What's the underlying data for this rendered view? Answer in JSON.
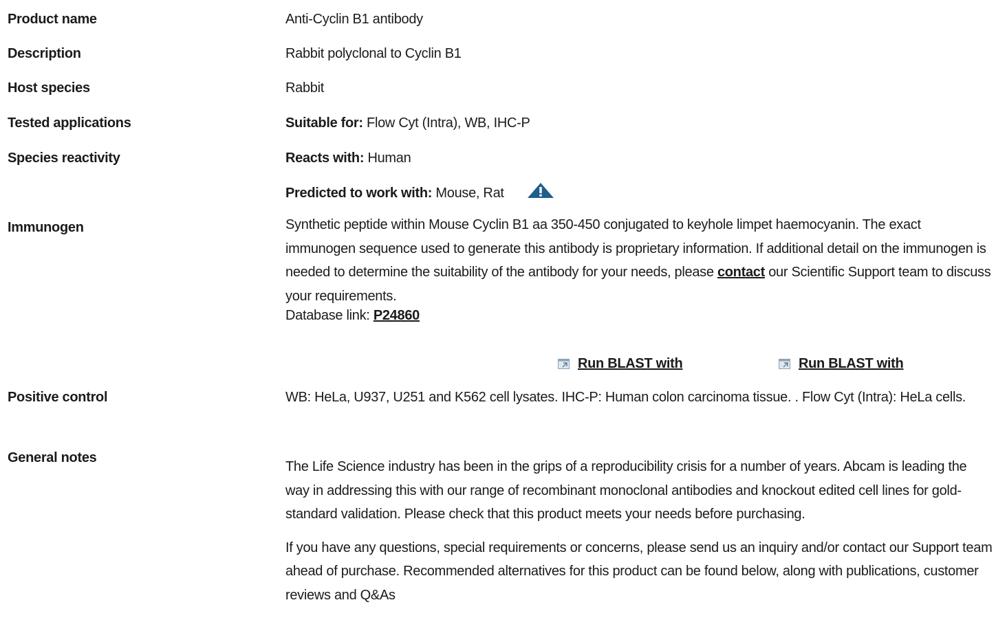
{
  "rows": {
    "product_name": {
      "label": "Product name",
      "value": "Anti-Cyclin B1 antibody"
    },
    "description": {
      "label": "Description",
      "value": "Rabbit polyclonal to Cyclin B1"
    },
    "host_species": {
      "label": "Host species",
      "value": "Rabbit"
    },
    "tested_applications": {
      "label": "Tested applications",
      "prefix": "Suitable for:",
      "value": "Flow Cyt (Intra), WB, IHC-P"
    },
    "species_reactivity": {
      "label": "Species reactivity",
      "reacts_prefix": "Reacts with:",
      "reacts_value": "Human",
      "predicted_prefix": "Predicted to work with:",
      "predicted_value": "Mouse, Rat",
      "warning_icon": "warning-triangle-icon"
    },
    "immunogen": {
      "label": "Immunogen",
      "text_before_link": "Synthetic peptide within Mouse Cyclin B1 aa 350-450 conjugated to keyhole limpet haemocyanin. The exact immunogen sequence used to generate this antibody is proprietary information. If additional detail on the immunogen is needed to determine the suitability of the antibody for your needs, please",
      "contact_link": "contact",
      "text_after_link": "our Scientific Support team to discuss your requirements.",
      "database_prefix": "Database link:",
      "database_link": "P24860",
      "blast_links": [
        "Run BLAST with",
        "Run BLAST with"
      ],
      "blast_icon": "external-link-icon"
    },
    "positive_control": {
      "label": "Positive control",
      "value": "WB: HeLa, U937, U251 and K562 cell lysates. IHC-P: Human colon carcinoma tissue. . Flow Cyt (Intra): HeLa cells."
    },
    "general_notes": {
      "label": "General notes",
      "paragraph_1": "The Life Science industry has been in the grips of a reproducibility crisis for a number of years. Abcam is leading the way in addressing this with our range of recombinant monoclonal antibodies and knockout edited cell lines for gold-standard validation. Please check that this product meets your needs before purchasing.",
      "paragraph_2": "If you have any questions, special requirements or concerns, please send us an inquiry and/or contact our Support team ahead of purchase. Recommended alternatives for this product can be found below, along with publications, customer reviews and Q&As"
    }
  },
  "colors": {
    "text": "#1b1b1b",
    "icon_blue": "#1f5f8b",
    "link": "#1b1b1b"
  }
}
